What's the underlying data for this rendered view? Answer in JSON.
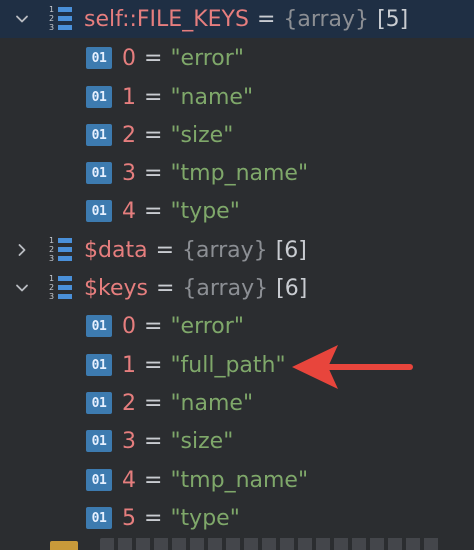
{
  "theme": {
    "selected_row_bg": "#1f2f44",
    "var_color": "#e67e7e",
    "string_color": "#7fa86a",
    "type_color": "#8c8f94",
    "field_icon_bg": "#3d7bb0",
    "arrow_color": "#e8453c"
  },
  "tree": {
    "file_keys": {
      "name": "self::FILE_KEYS",
      "eq": "=",
      "type": "{array}",
      "count": "[5]",
      "expanded": true,
      "icon": "array-icon",
      "items": [
        {
          "badge": "01",
          "index": "0",
          "eq": "=",
          "value": "\"error\""
        },
        {
          "badge": "01",
          "index": "1",
          "eq": "=",
          "value": "\"name\""
        },
        {
          "badge": "01",
          "index": "2",
          "eq": "=",
          "value": "\"size\""
        },
        {
          "badge": "01",
          "index": "3",
          "eq": "=",
          "value": "\"tmp_name\""
        },
        {
          "badge": "01",
          "index": "4",
          "eq": "=",
          "value": "\"type\""
        }
      ]
    },
    "data": {
      "name": "$data",
      "eq": "=",
      "type": "{array}",
      "count": "[6]",
      "expanded": false,
      "icon": "array-icon"
    },
    "keys": {
      "name": "$keys",
      "eq": "=",
      "type": "{array}",
      "count": "[6]",
      "expanded": true,
      "icon": "array-icon",
      "items": [
        {
          "badge": "01",
          "index": "0",
          "eq": "=",
          "value": "\"error\""
        },
        {
          "badge": "01",
          "index": "1",
          "eq": "=",
          "value": "\"full_path\""
        },
        {
          "badge": "01",
          "index": "2",
          "eq": "=",
          "value": "\"name\""
        },
        {
          "badge": "01",
          "index": "3",
          "eq": "=",
          "value": "\"size\""
        },
        {
          "badge": "01",
          "index": "4",
          "eq": "=",
          "value": "\"tmp_name\""
        },
        {
          "badge": "01",
          "index": "5",
          "eq": "=",
          "value": "\"type\""
        }
      ]
    }
  },
  "annotation": {
    "icon": "red-arrow-icon",
    "points_to": "full_path"
  }
}
